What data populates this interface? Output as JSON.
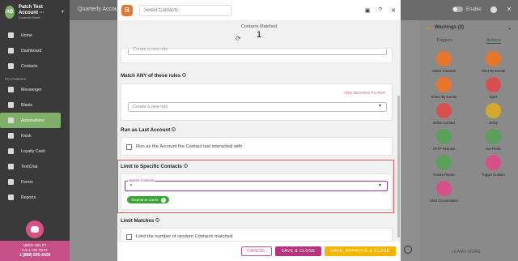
{
  "sidebar": {
    "account": {
      "initials": "AB",
      "name": "Patch Test Account ···",
      "sub": "Amanda Sheet"
    },
    "items": [
      {
        "label": "Home"
      },
      {
        "label": "Dashboard"
      },
      {
        "label": "Contacts"
      }
    ],
    "section_label": "Pro Features",
    "pro_items": [
      {
        "label": "Messenger"
      },
      {
        "label": "Blasts"
      },
      {
        "label": "Automations"
      },
      {
        "label": "Kiosk"
      },
      {
        "label": "Loyalty Cash"
      },
      {
        "label": "TextChat"
      },
      {
        "label": "Forms"
      },
      {
        "label": "Reports"
      }
    ],
    "help": {
      "line1": "NEED HELP?",
      "line2": "CALL OR TEXT",
      "phone": "1 (888) 605-4429"
    }
  },
  "topbar": {
    "title": "Quarterly Accou",
    "enable_label": "Enable"
  },
  "modal": {
    "search_placeholder": "Select Contacts",
    "contacts_matched_label": "Contacts Matched",
    "contacts_matched_count": "1",
    "create_rule_top": "Create a new rule",
    "match_any_title": "Match ANY of these rules",
    "add_nested_filter": "ADD NESTED FILTER",
    "create_rule": "Create a new rule",
    "run_as_title": "Run as Last Account",
    "run_as_checkbox": "Run as the Account the Contact last interacted with",
    "limit_contacts_title": "Limit to Specific Contacts",
    "search_contacts_label": "Search Contacts",
    "selected_contact": "Stephanie Carter",
    "limit_matches_title": "Limit Matches",
    "limit_matches_checkbox": "Limit the number of random Contacts matched",
    "buttons": {
      "cancel": "CANCEL",
      "save_close": "SAVE & CLOSE",
      "save_approve_close": "SAVE, APPROVE & CLOSE"
    }
  },
  "right_panel": {
    "warnings": "Warnings (2)",
    "tabs": [
      "Triggers",
      "Actions"
    ],
    "active_tab": "Actions",
    "actions": [
      {
        "label": "Select Contacts",
        "color": "#e8752a"
      },
      {
        "label": "Filter By Events",
        "color": "#e8752a"
      },
      {
        "label": "Select By Events",
        "color": "#e8752a"
      },
      {
        "label": "Eject",
        "color": "#d94f4f"
      },
      {
        "label": "Delete Contact",
        "color": "#d94f4f"
      },
      {
        "label": "Delay",
        "color": "#d4a82a"
      },
      {
        "label": "HTTP Request",
        "color": "#5aa05a"
      },
      {
        "label": "Set Fields",
        "color": "#5aa05a"
      },
      {
        "label": "Create Report",
        "color": "#5aa05a"
      },
      {
        "label": "Trigger Custom",
        "color": "#d94f88"
      },
      {
        "label": "Start Conversation",
        "color": "#d94f88"
      }
    ],
    "learn_more": "LEARN MORE"
  },
  "colors": {
    "accent_green": "#7fb069",
    "brand_pink": "#b8327e",
    "approve_yellow": "#f5b400",
    "highlight_red": "#e05a5a"
  }
}
